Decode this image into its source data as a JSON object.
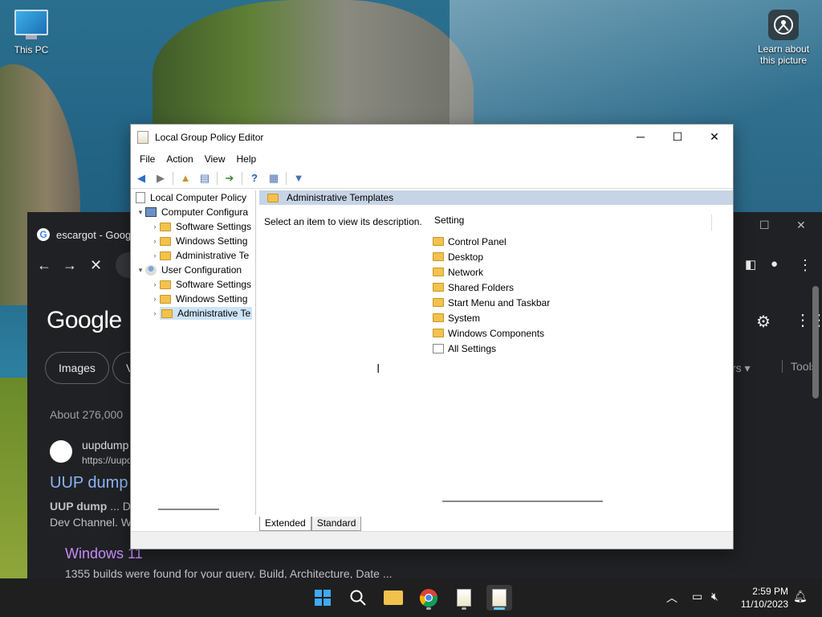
{
  "desktop": {
    "icons": [
      {
        "label": "This PC"
      },
      {
        "label": "Learn about this picture"
      }
    ]
  },
  "chrome": {
    "tab_title": "escargot - Goog",
    "search_logo": "Google",
    "chips": [
      "Images",
      "V"
    ],
    "right_filter": "rs",
    "tools_label": "Tools",
    "results_count": "About 276,000",
    "result": {
      "site": "uupdump",
      "url": "https://uupd",
      "title": "UUP dump",
      "snippet_bold": "UUP dump",
      "snippet_rest": " ... D",
      "snippet_line2": "Dev Channel. W",
      "sublink_title": "Windows 11",
      "sublink_desc": "1355 builds were found for your query. Build, Architecture, Date ..."
    }
  },
  "gpedit": {
    "title": "Local Group Policy Editor",
    "menu": [
      "File",
      "Action",
      "View",
      "Help"
    ],
    "tree": [
      {
        "label": "Local Computer Policy",
        "level": 0
      },
      {
        "label": "Computer Configura",
        "level": 1,
        "expanded": true
      },
      {
        "label": "Software Settings",
        "level": 2
      },
      {
        "label": "Windows Setting",
        "level": 2
      },
      {
        "label": "Administrative Te",
        "level": 2
      },
      {
        "label": "User Configuration",
        "level": 1,
        "expanded": true
      },
      {
        "label": "Software Settings",
        "level": 2
      },
      {
        "label": "Windows Setting",
        "level": 2
      },
      {
        "label": "Administrative Te",
        "level": 2,
        "selected": true
      }
    ],
    "right_header": "Administrative Templates",
    "description": "Select an item to view its description.",
    "column_header": "Setting",
    "items": [
      "Control Panel",
      "Desktop",
      "Network",
      "Shared Folders",
      "Start Menu and Taskbar",
      "System",
      "Windows Components",
      "All Settings"
    ],
    "tabs": [
      "Extended",
      "Standard"
    ]
  },
  "taskbar": {
    "time": "2:59 PM",
    "date": "11/10/2023",
    "accent": "#60cdff"
  }
}
